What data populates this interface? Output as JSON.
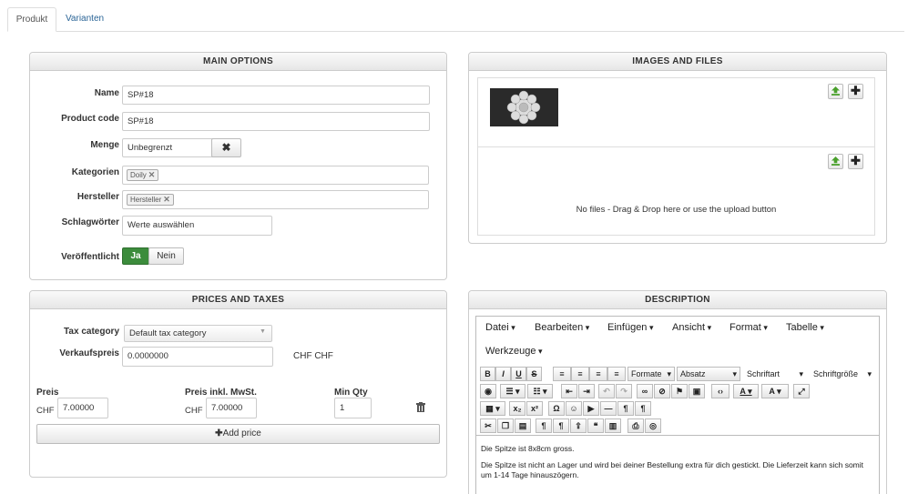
{
  "tabs": [
    {
      "label": "Produkt",
      "active": true
    },
    {
      "label": "Varianten",
      "active": false
    }
  ],
  "main_options": {
    "title": "MAIN OPTIONS",
    "name_label": "Name",
    "name_value": "SP#18",
    "code_label": "Product code",
    "code_value": "SP#18",
    "menge_label": "Menge",
    "menge_value": "Unbegrenzt",
    "menge_clear": "✖",
    "kategorien_label": "Kategorien",
    "kategorien_tag": "Doily",
    "hersteller_label": "Hersteller",
    "hersteller_tag": "Hersteller",
    "schlag_label": "Schlagwörter",
    "schlag_placeholder": "Werte auswählen",
    "veroeff_label": "Veröffentlicht",
    "ja": "Ja",
    "nein": "Nein",
    "tag_remove": "✕"
  },
  "images": {
    "title": "IMAGES AND FILES",
    "no_files": "No files - Drag & Drop here or use the upload button",
    "plus": "✚"
  },
  "prices": {
    "title": "PRICES AND TAXES",
    "tax_label": "Tax category",
    "tax_value": "Default tax category",
    "vk_label": "Verkaufspreis",
    "vk_value": "0.0000000",
    "vk_currency": "CHF CHF",
    "col_preis": "Preis",
    "col_inkl": "Preis inkl. MwSt.",
    "col_minqty": "Min Qty",
    "currency": "CHF",
    "preis_value": "7.00000",
    "inkl_value": "7.00000",
    "minqty_value": "1",
    "add_price": "Add price",
    "add_icon": "✚",
    "trash_icon": "trash-icon"
  },
  "description": {
    "title": "DESCRIPTION",
    "menus": [
      "Datei",
      "Bearbeiten",
      "Einfügen",
      "Ansicht",
      "Format",
      "Tabelle",
      "Werkzeuge"
    ],
    "formats_select": "Formate",
    "absatz_select": "Absatz",
    "schriftart_select": "Schriftart",
    "groesse_select": "Schriftgröße",
    "tb_bold": "B",
    "tb_italic": "I",
    "tb_underline": "U",
    "tb_strike": "S",
    "text_p1": "Die Spitze ist 8x8cm gross.",
    "text_p2": "Die Spitze ist nicht an Lager und wird bei deiner Bestellung extra für dich gestickt. Die Lieferzeit kann sich somit um 1-14 Tage hinauszögern."
  }
}
